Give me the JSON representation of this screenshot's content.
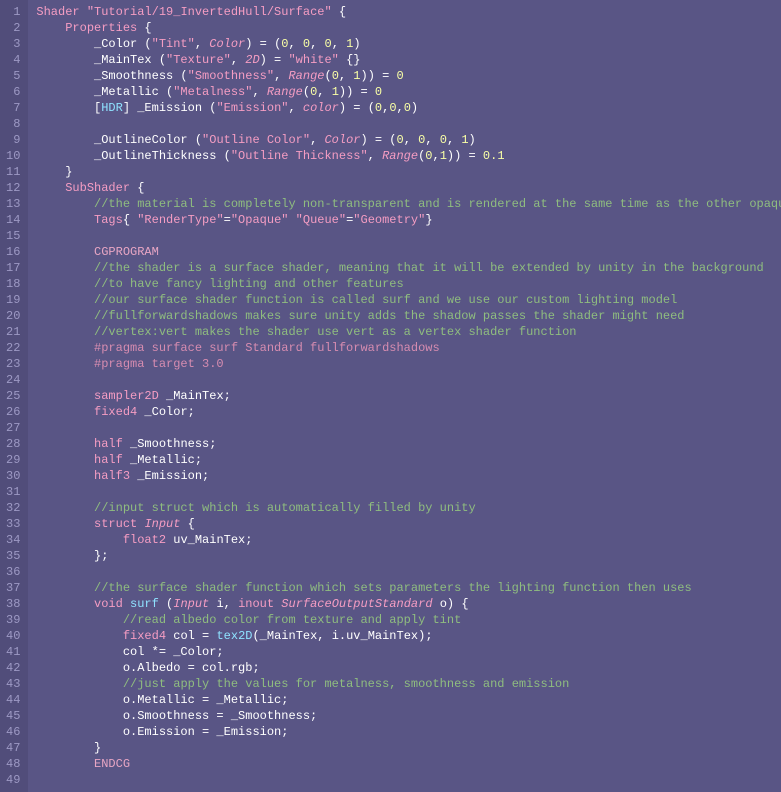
{
  "lines": [
    {
      "n": 1,
      "segs": [
        {
          "c": "kw",
          "t": "Shader "
        },
        {
          "c": "str",
          "t": "\"Tutorial/19_InvertedHull/Surface\""
        },
        {
          "c": "whi",
          "t": " {"
        }
      ]
    },
    {
      "n": 2,
      "segs": [
        {
          "c": "whi",
          "t": "    "
        },
        {
          "c": "kw",
          "t": "Properties"
        },
        {
          "c": "whi",
          "t": " {"
        }
      ]
    },
    {
      "n": 3,
      "segs": [
        {
          "c": "whi",
          "t": "        _Color ("
        },
        {
          "c": "str",
          "t": "\"Tint\""
        },
        {
          "c": "whi",
          "t": ", "
        },
        {
          "c": "type",
          "t": "Color"
        },
        {
          "c": "whi",
          "t": ") = ("
        },
        {
          "c": "num",
          "t": "0"
        },
        {
          "c": "whi",
          "t": ", "
        },
        {
          "c": "num",
          "t": "0"
        },
        {
          "c": "whi",
          "t": ", "
        },
        {
          "c": "num",
          "t": "0"
        },
        {
          "c": "whi",
          "t": ", "
        },
        {
          "c": "num",
          "t": "1"
        },
        {
          "c": "whi",
          "t": ")"
        }
      ]
    },
    {
      "n": 4,
      "segs": [
        {
          "c": "whi",
          "t": "        _MainTex ("
        },
        {
          "c": "str",
          "t": "\"Texture\""
        },
        {
          "c": "whi",
          "t": ", "
        },
        {
          "c": "type",
          "t": "2D"
        },
        {
          "c": "whi",
          "t": ") = "
        },
        {
          "c": "str",
          "t": "\"white\""
        },
        {
          "c": "whi",
          "t": " {}"
        }
      ]
    },
    {
      "n": 5,
      "segs": [
        {
          "c": "whi",
          "t": "        _Smoothness ("
        },
        {
          "c": "str",
          "t": "\"Smoothness\""
        },
        {
          "c": "whi",
          "t": ", "
        },
        {
          "c": "type",
          "t": "Range"
        },
        {
          "c": "whi",
          "t": "("
        },
        {
          "c": "num",
          "t": "0"
        },
        {
          "c": "whi",
          "t": ", "
        },
        {
          "c": "num",
          "t": "1"
        },
        {
          "c": "whi",
          "t": ")) = "
        },
        {
          "c": "num",
          "t": "0"
        }
      ]
    },
    {
      "n": 6,
      "segs": [
        {
          "c": "whi",
          "t": "        _Metallic ("
        },
        {
          "c": "str",
          "t": "\"Metalness\""
        },
        {
          "c": "whi",
          "t": ", "
        },
        {
          "c": "type",
          "t": "Range"
        },
        {
          "c": "whi",
          "t": "("
        },
        {
          "c": "num",
          "t": "0"
        },
        {
          "c": "whi",
          "t": ", "
        },
        {
          "c": "num",
          "t": "1"
        },
        {
          "c": "whi",
          "t": ")) = "
        },
        {
          "c": "num",
          "t": "0"
        }
      ]
    },
    {
      "n": 7,
      "segs": [
        {
          "c": "whi",
          "t": "        ["
        },
        {
          "c": "fn",
          "t": "HDR"
        },
        {
          "c": "whi",
          "t": "] _Emission ("
        },
        {
          "c": "str",
          "t": "\"Emission\""
        },
        {
          "c": "whi",
          "t": ", "
        },
        {
          "c": "type",
          "t": "color"
        },
        {
          "c": "whi",
          "t": ") = ("
        },
        {
          "c": "num",
          "t": "0"
        },
        {
          "c": "whi",
          "t": ","
        },
        {
          "c": "num",
          "t": "0"
        },
        {
          "c": "whi",
          "t": ","
        },
        {
          "c": "num",
          "t": "0"
        },
        {
          "c": "whi",
          "t": ")"
        }
      ]
    },
    {
      "n": 8,
      "segs": [
        {
          "c": "whi",
          "t": ""
        }
      ]
    },
    {
      "n": 9,
      "segs": [
        {
          "c": "whi",
          "t": "        _OutlineColor ("
        },
        {
          "c": "str",
          "t": "\"Outline Color\""
        },
        {
          "c": "whi",
          "t": ", "
        },
        {
          "c": "type",
          "t": "Color"
        },
        {
          "c": "whi",
          "t": ") = ("
        },
        {
          "c": "num",
          "t": "0"
        },
        {
          "c": "whi",
          "t": ", "
        },
        {
          "c": "num",
          "t": "0"
        },
        {
          "c": "whi",
          "t": ", "
        },
        {
          "c": "num",
          "t": "0"
        },
        {
          "c": "whi",
          "t": ", "
        },
        {
          "c": "num",
          "t": "1"
        },
        {
          "c": "whi",
          "t": ")"
        }
      ]
    },
    {
      "n": 10,
      "segs": [
        {
          "c": "whi",
          "t": "        _OutlineThickness ("
        },
        {
          "c": "str",
          "t": "\"Outline Thickness\""
        },
        {
          "c": "whi",
          "t": ", "
        },
        {
          "c": "type",
          "t": "Range"
        },
        {
          "c": "whi",
          "t": "("
        },
        {
          "c": "num",
          "t": "0"
        },
        {
          "c": "whi",
          "t": ","
        },
        {
          "c": "num",
          "t": "1"
        },
        {
          "c": "whi",
          "t": ")) = "
        },
        {
          "c": "num",
          "t": "0.1"
        }
      ]
    },
    {
      "n": 11,
      "segs": [
        {
          "c": "whi",
          "t": "    }"
        }
      ]
    },
    {
      "n": 12,
      "segs": [
        {
          "c": "whi",
          "t": "    "
        },
        {
          "c": "kw",
          "t": "SubShader"
        },
        {
          "c": "whi",
          "t": " {"
        }
      ]
    },
    {
      "n": 13,
      "segs": [
        {
          "c": "whi",
          "t": "        "
        },
        {
          "c": "cmt",
          "t": "//the material is completely non-transparent and is rendered at the same time as the other opaque geometry"
        }
      ]
    },
    {
      "n": 14,
      "segs": [
        {
          "c": "whi",
          "t": "        "
        },
        {
          "c": "kw",
          "t": "Tags"
        },
        {
          "c": "whi",
          "t": "{ "
        },
        {
          "c": "str",
          "t": "\"RenderType\""
        },
        {
          "c": "whi",
          "t": "="
        },
        {
          "c": "str",
          "t": "\"Opaque\""
        },
        {
          "c": "whi",
          "t": " "
        },
        {
          "c": "str",
          "t": "\"Queue\""
        },
        {
          "c": "whi",
          "t": "="
        },
        {
          "c": "str",
          "t": "\"Geometry\""
        },
        {
          "c": "whi",
          "t": "}"
        }
      ]
    },
    {
      "n": 15,
      "segs": [
        {
          "c": "whi",
          "t": ""
        }
      ]
    },
    {
      "n": 16,
      "segs": [
        {
          "c": "whi",
          "t": "        "
        },
        {
          "c": "dir",
          "t": "CGPROGRAM"
        }
      ]
    },
    {
      "n": 17,
      "segs": [
        {
          "c": "whi",
          "t": "        "
        },
        {
          "c": "cmt",
          "t": "//the shader is a surface shader, meaning that it will be extended by unity in the background"
        }
      ]
    },
    {
      "n": 18,
      "segs": [
        {
          "c": "whi",
          "t": "        "
        },
        {
          "c": "cmt",
          "t": "//to have fancy lighting and other features"
        }
      ]
    },
    {
      "n": 19,
      "segs": [
        {
          "c": "whi",
          "t": "        "
        },
        {
          "c": "cmt",
          "t": "//our surface shader function is called surf and we use our custom lighting model"
        }
      ]
    },
    {
      "n": 20,
      "segs": [
        {
          "c": "whi",
          "t": "        "
        },
        {
          "c": "cmt",
          "t": "//fullforwardshadows makes sure unity adds the shadow passes the shader might need"
        }
      ]
    },
    {
      "n": 21,
      "segs": [
        {
          "c": "whi",
          "t": "        "
        },
        {
          "c": "cmt",
          "t": "//vertex:vert makes the shader use vert as a vertex shader function"
        }
      ]
    },
    {
      "n": 22,
      "segs": [
        {
          "c": "whi",
          "t": "        "
        },
        {
          "c": "pp",
          "t": "#pragma surface surf Standard fullforwardshadows"
        }
      ]
    },
    {
      "n": 23,
      "segs": [
        {
          "c": "whi",
          "t": "        "
        },
        {
          "c": "pp",
          "t": "#pragma target 3.0"
        }
      ]
    },
    {
      "n": 24,
      "segs": [
        {
          "c": "whi",
          "t": ""
        }
      ]
    },
    {
      "n": 25,
      "segs": [
        {
          "c": "whi",
          "t": "        "
        },
        {
          "c": "kw",
          "t": "sampler2D"
        },
        {
          "c": "whi",
          "t": " _MainTex;"
        }
      ]
    },
    {
      "n": 26,
      "segs": [
        {
          "c": "whi",
          "t": "        "
        },
        {
          "c": "kw",
          "t": "fixed4"
        },
        {
          "c": "whi",
          "t": " _Color;"
        }
      ]
    },
    {
      "n": 27,
      "segs": [
        {
          "c": "whi",
          "t": ""
        }
      ]
    },
    {
      "n": 28,
      "segs": [
        {
          "c": "whi",
          "t": "        "
        },
        {
          "c": "kw",
          "t": "half"
        },
        {
          "c": "whi",
          "t": " _Smoothness;"
        }
      ]
    },
    {
      "n": 29,
      "segs": [
        {
          "c": "whi",
          "t": "        "
        },
        {
          "c": "kw",
          "t": "half"
        },
        {
          "c": "whi",
          "t": " _Metallic;"
        }
      ]
    },
    {
      "n": 30,
      "segs": [
        {
          "c": "whi",
          "t": "        "
        },
        {
          "c": "kw",
          "t": "half3"
        },
        {
          "c": "whi",
          "t": " _Emission;"
        }
      ]
    },
    {
      "n": 31,
      "segs": [
        {
          "c": "whi",
          "t": ""
        }
      ]
    },
    {
      "n": 32,
      "segs": [
        {
          "c": "whi",
          "t": "        "
        },
        {
          "c": "cmt",
          "t": "//input struct which is automatically filled by unity"
        }
      ]
    },
    {
      "n": 33,
      "segs": [
        {
          "c": "whi",
          "t": "        "
        },
        {
          "c": "kw",
          "t": "struct"
        },
        {
          "c": "whi",
          "t": " "
        },
        {
          "c": "type",
          "t": "Input"
        },
        {
          "c": "whi",
          "t": " {"
        }
      ]
    },
    {
      "n": 34,
      "segs": [
        {
          "c": "whi",
          "t": "            "
        },
        {
          "c": "kw",
          "t": "float2"
        },
        {
          "c": "whi",
          "t": " uv_MainTex;"
        }
      ]
    },
    {
      "n": 35,
      "segs": [
        {
          "c": "whi",
          "t": "        };"
        }
      ]
    },
    {
      "n": 36,
      "segs": [
        {
          "c": "whi",
          "t": ""
        }
      ]
    },
    {
      "n": 37,
      "segs": [
        {
          "c": "whi",
          "t": "        "
        },
        {
          "c": "cmt",
          "t": "//the surface shader function which sets parameters the lighting function then uses"
        }
      ]
    },
    {
      "n": 38,
      "segs": [
        {
          "c": "whi",
          "t": "        "
        },
        {
          "c": "kw",
          "t": "void"
        },
        {
          "c": "whi",
          "t": " "
        },
        {
          "c": "fn",
          "t": "surf"
        },
        {
          "c": "whi",
          "t": " ("
        },
        {
          "c": "type",
          "t": "Input"
        },
        {
          "c": "whi",
          "t": " i, "
        },
        {
          "c": "kw",
          "t": "inout"
        },
        {
          "c": "whi",
          "t": " "
        },
        {
          "c": "type",
          "t": "SurfaceOutputStandard"
        },
        {
          "c": "whi",
          "t": " o) {"
        }
      ]
    },
    {
      "n": 39,
      "segs": [
        {
          "c": "whi",
          "t": "            "
        },
        {
          "c": "cmt",
          "t": "//read albedo color from texture and apply tint"
        }
      ]
    },
    {
      "n": 40,
      "segs": [
        {
          "c": "whi",
          "t": "            "
        },
        {
          "c": "kw",
          "t": "fixed4"
        },
        {
          "c": "whi",
          "t": " col = "
        },
        {
          "c": "fn",
          "t": "tex2D"
        },
        {
          "c": "whi",
          "t": "(_MainTex, i.uv_MainTex);"
        }
      ]
    },
    {
      "n": 41,
      "segs": [
        {
          "c": "whi",
          "t": "            col *= _Color;"
        }
      ]
    },
    {
      "n": 42,
      "segs": [
        {
          "c": "whi",
          "t": "            o.Albedo = col.rgb;"
        }
      ]
    },
    {
      "n": 43,
      "segs": [
        {
          "c": "whi",
          "t": "            "
        },
        {
          "c": "cmt",
          "t": "//just apply the values for metalness, smoothness and emission"
        }
      ]
    },
    {
      "n": 44,
      "segs": [
        {
          "c": "whi",
          "t": "            o.Metallic = _Metallic;"
        }
      ]
    },
    {
      "n": 45,
      "segs": [
        {
          "c": "whi",
          "t": "            o.Smoothness = _Smoothness;"
        }
      ]
    },
    {
      "n": 46,
      "segs": [
        {
          "c": "whi",
          "t": "            o.Emission = _Emission;"
        }
      ]
    },
    {
      "n": 47,
      "segs": [
        {
          "c": "whi",
          "t": "        }"
        }
      ]
    },
    {
      "n": 48,
      "segs": [
        {
          "c": "whi",
          "t": "        "
        },
        {
          "c": "dir",
          "t": "ENDCG"
        }
      ]
    },
    {
      "n": 49,
      "segs": [
        {
          "c": "whi",
          "t": ""
        }
      ]
    }
  ]
}
